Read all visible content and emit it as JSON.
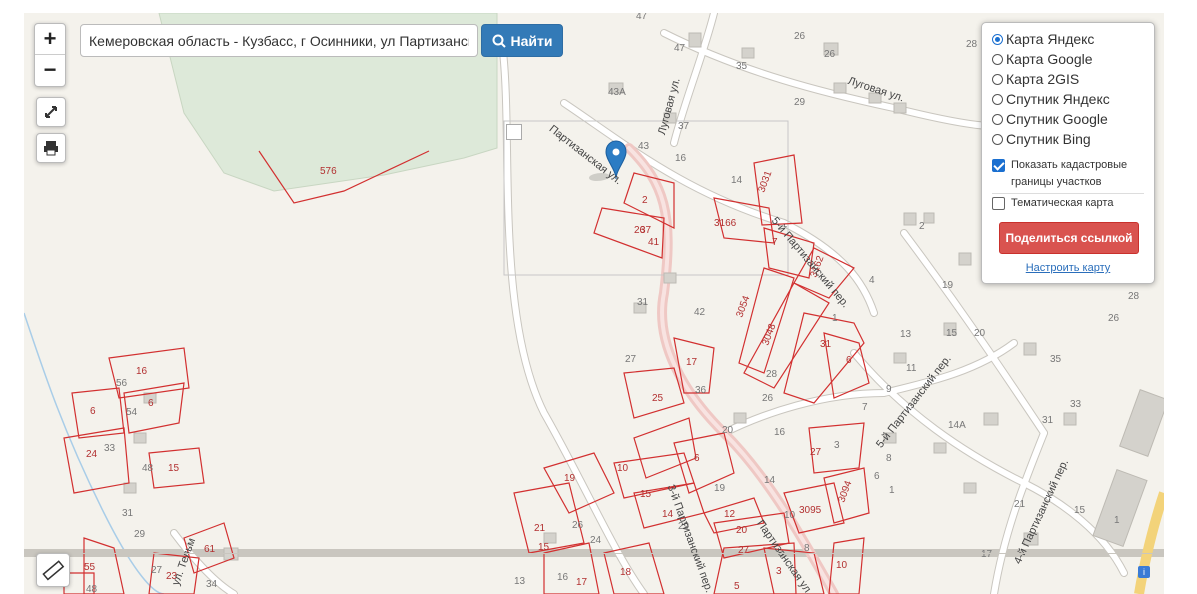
{
  "search": {
    "value": "Кемеровская область - Кузбасс, г Осинники, ул Партизанская",
    "button_label": "Найти"
  },
  "zoom": {
    "in_label": "+",
    "out_label": "−"
  },
  "layers": {
    "options": [
      {
        "label": "Карта Яндекс",
        "selected": true
      },
      {
        "label": "Карта Google",
        "selected": false
      },
      {
        "label": "Карта 2GIS",
        "selected": false
      },
      {
        "label": "Спутник Яндекс",
        "selected": false
      },
      {
        "label": "Спутник Google",
        "selected": false
      },
      {
        "label": "Спутник Bing",
        "selected": false
      }
    ],
    "show_cadastral_label": "Показать кадастровые границы участков",
    "show_cadastral_checked": true,
    "thematic_label": "Тематическая карта",
    "thematic_checked": false,
    "share_label": "Поделиться ссылкой",
    "configure_label": "Настроить карту"
  },
  "map": {
    "street_labels": [
      "Партизанская ул.",
      "Луговая ул.",
      "Луговая ул.",
      "5-й Партизанский пер.",
      "5-й Партизанский пер.",
      "4-й Партизанский пер.",
      "3-й Партизанский пер.",
      "Партизанская ул.",
      "ул. Тельм"
    ],
    "house_numbers": [
      "47",
      "26",
      "28",
      "47",
      "35",
      "29",
      "43А",
      "37",
      "43",
      "16",
      "14",
      "3031",
      "2",
      "37",
      "26",
      "41",
      "3166",
      "7",
      "3162",
      "2",
      "4",
      "19",
      "28",
      "26",
      "576",
      "31",
      "42",
      "3054",
      "3048",
      "1",
      "31",
      "6",
      "13",
      "15",
      "20",
      "11",
      "9",
      "27",
      "17",
      "25",
      "36",
      "28",
      "26",
      "7",
      "35",
      "33",
      "31",
      "14А",
      "16",
      "56",
      "6",
      "54",
      "6",
      "33",
      "24",
      "48",
      "15",
      "23",
      "20",
      "16",
      "27",
      "3",
      "8",
      "6",
      "1",
      "19",
      "10",
      "21",
      "19",
      "14",
      "15",
      "3094",
      "6",
      "5",
      "31",
      "17",
      "10",
      "21",
      "14",
      "12",
      "20",
      "17",
      "3095",
      "29",
      "21",
      "15",
      "24",
      "10",
      "27",
      "8",
      "23",
      "61",
      "55",
      "48",
      "34",
      "13",
      "17",
      "16",
      "18",
      "5",
      "3",
      "10"
    ],
    "colors": {
      "background": "#f4f2ec",
      "forest": "#dde9d9",
      "parcel": "#d23030",
      "road_main": "#efc8c4",
      "road": "#bdbdbd",
      "marker": "#2b7cc4"
    }
  }
}
